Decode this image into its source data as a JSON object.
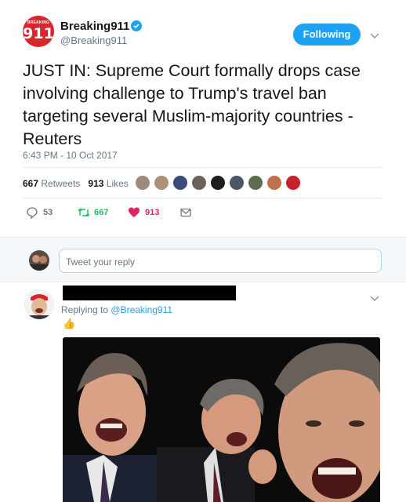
{
  "tweet": {
    "avatar": {
      "top_text": "BREAKING",
      "number": "911",
      "color": "#d8262c"
    },
    "name": "Breaking911",
    "handle": "@Breaking911",
    "follow_label": "Following",
    "text": "JUST IN: Supreme Court formally drops case involving challenge to Trump's travel ban targeting several Muslim-majority countries - Reuters",
    "timestamp": "6:43 PM - 10 Oct 2017",
    "stats": {
      "retweets_count": "667",
      "retweets_label": "Retweets",
      "likes_count": "913",
      "likes_label": "Likes"
    },
    "actions": {
      "reply_count": "53",
      "retweet_count": "667",
      "like_count": "913"
    },
    "icons": [
      "verified-badge-icon",
      "chevron-down-icon",
      "reply-icon",
      "retweet-icon",
      "heart-icon",
      "envelope-icon"
    ]
  },
  "reply_box": {
    "placeholder": "Tweet your reply"
  },
  "reply_tweet": {
    "replying_prefix": "Replying to",
    "replying_handle": "@Breaking911",
    "emoji": "👍"
  },
  "colors": {
    "accent": "#1da1f2",
    "retweet": "#17bf63",
    "like": "#e0245e",
    "muted": "#657786"
  }
}
